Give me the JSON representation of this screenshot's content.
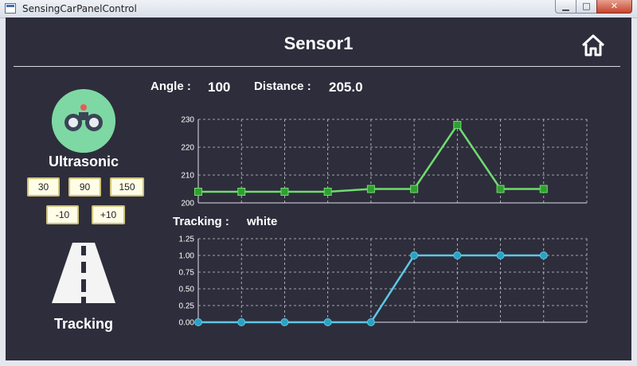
{
  "window": {
    "title": "SensingCarPanelControl",
    "controls": {
      "minimize": "▁",
      "maximize": "□",
      "close": "✕"
    }
  },
  "header": {
    "title": "Sensor1",
    "home_icon": "home-icon"
  },
  "readout": {
    "angle_label": "Angle :",
    "angle_value": "100",
    "distance_label": "Distance :",
    "distance_value": "205.0",
    "tracking_label": "Tracking :",
    "tracking_value": "white"
  },
  "ultrasonic": {
    "label": "Ultrasonic",
    "icon": "binoculars-icon",
    "angle_buttons": [
      "30",
      "90",
      "150"
    ],
    "step_buttons": [
      "-10",
      "+10"
    ]
  },
  "tracking": {
    "label": "Tracking",
    "icon": "road-icon"
  },
  "colors": {
    "background": "#2e2d3c",
    "distance_series": "#6fdc6f",
    "distance_marker": "#2fa02f",
    "tracking_series": "#5ec8e6",
    "tracking_marker": "#2aa2c2",
    "icon_circle": "#7ed8a3"
  },
  "chart_data": [
    {
      "type": "line",
      "x": [
        1,
        2,
        3,
        4,
        5,
        6,
        7,
        8,
        9
      ],
      "series": [
        {
          "values": [
            204,
            204,
            204,
            204,
            205,
            205,
            228,
            205,
            205
          ]
        }
      ],
      "yticks": [
        "200",
        "210",
        "220",
        "230"
      ],
      "ylim": [
        200,
        230
      ],
      "grid": true
    },
    {
      "type": "line",
      "x": [
        1,
        2,
        3,
        4,
        5,
        6,
        7,
        8,
        9
      ],
      "series": [
        {
          "values": [
            0,
            0,
            0,
            0,
            0,
            1,
            1,
            1,
            1
          ]
        }
      ],
      "yticks": [
        "0.00",
        "0.25",
        "0.50",
        "0.75",
        "1.00",
        "1.25"
      ],
      "ylim": [
        0,
        1.25
      ],
      "grid": true
    }
  ]
}
